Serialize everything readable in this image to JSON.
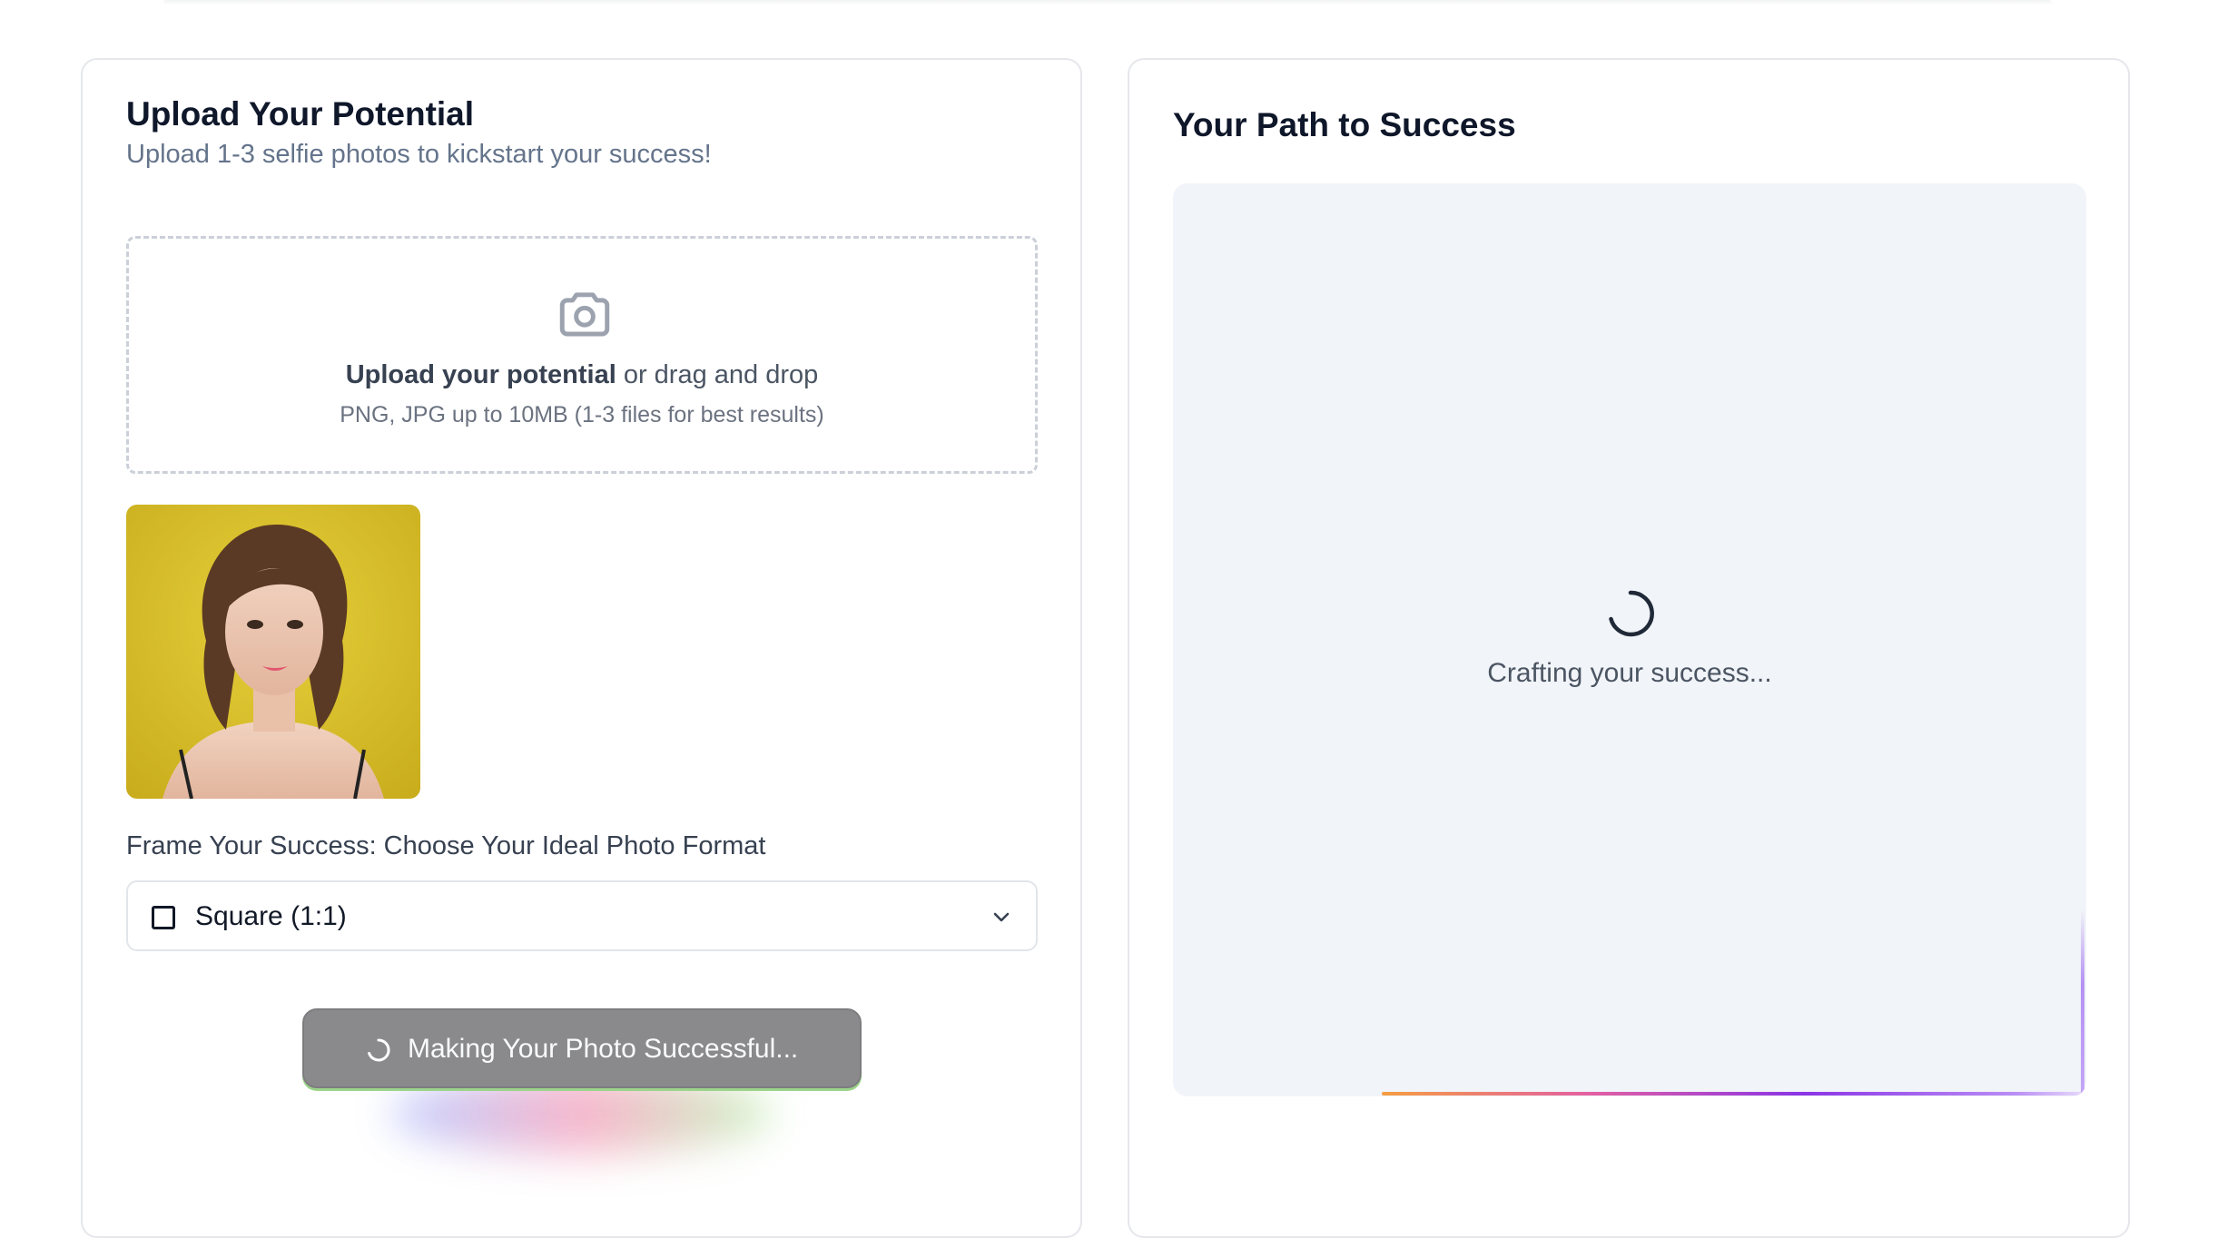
{
  "upload_card": {
    "title": "Upload Your Potential",
    "subtitle": "Upload 1-3 selfie photos to kickstart your success!",
    "dropzone": {
      "icon": "camera-icon",
      "main_strong": "Upload your potential",
      "main_rest": " or drag and drop",
      "hint": "PNG, JPG up to 10MB (1-3 files for best results)"
    },
    "format": {
      "label": "Frame Your Success: Choose Your Ideal Photo Format",
      "icon": "square-icon",
      "selected": "Square (1:1)"
    },
    "action_button": {
      "label": "Making Your Photo Successful...",
      "state": "loading"
    }
  },
  "result_card": {
    "title": "Your Path to Success",
    "status": "Crafting your success..."
  },
  "colors": {
    "title": "#0f172a",
    "muted": "#64748b",
    "button_bg": "#8a8a8d",
    "preview_bg": "#f1f4f8",
    "accent_purple": "#8b34e6",
    "accent_orange": "#f59e42"
  }
}
